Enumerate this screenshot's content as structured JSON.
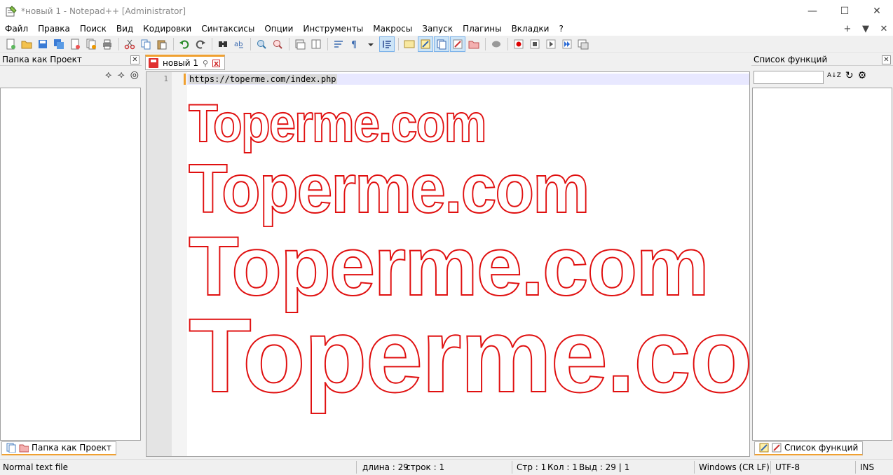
{
  "window": {
    "title": "*новый 1 - Notepad++ [Administrator]",
    "controls": {
      "minimize": "—",
      "maximize": "☐",
      "close": "✕"
    }
  },
  "menu": {
    "items": [
      "Файл",
      "Правка",
      "Поиск",
      "Вид",
      "Кодировки",
      "Синтаксисы",
      "Опции",
      "Инструменты",
      "Макросы",
      "Запуск",
      "Плагины",
      "Вкладки",
      "?"
    ],
    "right": [
      "+",
      "▼",
      "✕"
    ]
  },
  "toolbar": {
    "icons": [
      "new-file-icon",
      "open-file-icon",
      "save-icon",
      "save-all-icon",
      "close-icon",
      "close-all-icon",
      "print-icon",
      "cut-icon",
      "copy-icon",
      "paste-icon",
      "undo-icon",
      "redo-icon",
      "find-icon",
      "replace-icon",
      "zoom-in-icon",
      "zoom-out-icon",
      "sync-v-icon",
      "sync-h-icon",
      "word-wrap-icon",
      "all-chars-icon",
      "indent-guide-icon",
      "doc-map-icon",
      "function-list-icon",
      "folder-workspace-icon",
      "monitoring-icon",
      "record-macro-icon",
      "stop-macro-icon",
      "play-macro-icon",
      "run-macro-multiple-icon",
      "save-macro-icon"
    ]
  },
  "left_panel": {
    "title": "Папка как Проект",
    "close": "✕",
    "tools": [
      "⟡",
      "⟢",
      "◎"
    ],
    "tab_label": "Папка как Проект"
  },
  "right_panel": {
    "title": "Список функций",
    "close": "✕",
    "search_value": "",
    "tools": [
      "A↓Z",
      "↻",
      "⚙"
    ],
    "tab_label": "Список функций"
  },
  "editor": {
    "tab_label": "новый 1",
    "tab_pin": "⚲",
    "tab_close": "x",
    "line_number": "1",
    "line_text": "https://toperme.com/index.php",
    "brand_text": "Toperme.com",
    "brand_color": "#e01010"
  },
  "status": {
    "type": "Normal text file",
    "length": "длина : 29",
    "lines": "строк : 1",
    "ln": "Стр : 1",
    "col": "Кол : 1",
    "sel": "Выд : 29 | 1",
    "eol": "Windows (CR LF)",
    "encoding": "UTF-8",
    "mode": "INS"
  }
}
